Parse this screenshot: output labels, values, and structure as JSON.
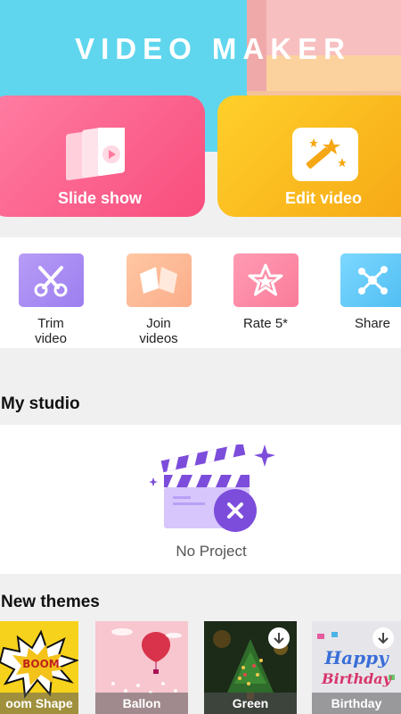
{
  "header": {
    "title": "VIDEO MAKER"
  },
  "cards": {
    "slideshow": {
      "label": "Slide show",
      "icon": "slideshow-frames-icon"
    },
    "edit": {
      "label": "Edit video",
      "icon": "magic-wand-icon"
    }
  },
  "tools": [
    {
      "label": "Trim video",
      "icon": "scissors-icon"
    },
    {
      "label": "Join videos",
      "icon": "join-icon"
    },
    {
      "label": "Rate 5*",
      "icon": "star-icon"
    },
    {
      "label": "Share",
      "icon": "share-icon"
    }
  ],
  "studio": {
    "title": "My studio",
    "empty_text": "No Project",
    "icon": "clapperboard-icon"
  },
  "themes": {
    "title": "New themes",
    "items": [
      {
        "label": "oom Shape",
        "thumb_text": "BOOM"
      },
      {
        "label": "Ballon"
      },
      {
        "label": "Green",
        "icon": "download-icon"
      },
      {
        "label": "Birthday",
        "thumb_text": "Happy Birthday",
        "icon": "download-icon"
      }
    ]
  },
  "colors": {
    "header_cyan": "#5fd6ee",
    "slideshow_pink": "#f84d7d",
    "edit_yellow": "#f6a715",
    "studio_purple": "#7c4ddb"
  }
}
